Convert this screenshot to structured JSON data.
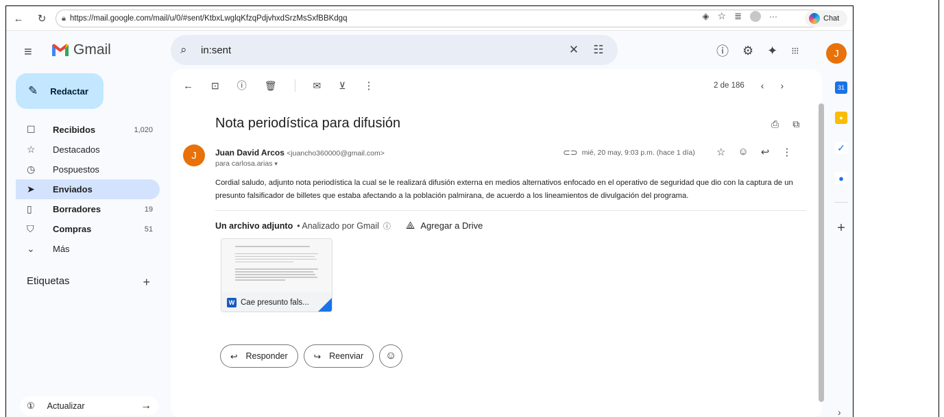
{
  "browser": {
    "url": "https://mail.google.com/mail/u/0/#sent/KtbxLwglqKfzqPdjvhxdSrzMsSxfBBKdgq",
    "chat_label": "Chat",
    "more": "···"
  },
  "header": {
    "brand": "Gmail",
    "search_value": "in:sent",
    "avatar_letter": "J"
  },
  "sidebar": {
    "compose_label": "Redactar",
    "items": [
      {
        "label": "Recibidos",
        "count": "1,020",
        "icon": "inbox-icon",
        "glyph": "☐",
        "bold": true
      },
      {
        "label": "Destacados",
        "count": "",
        "icon": "star-icon",
        "glyph": "☆",
        "bold": false
      },
      {
        "label": "Pospuestos",
        "count": "",
        "icon": "clock-icon",
        "glyph": "◷",
        "bold": false
      },
      {
        "label": "Enviados",
        "count": "",
        "icon": "send-icon",
        "glyph": "➤",
        "bold": true
      },
      {
        "label": "Borradores",
        "count": "19",
        "icon": "draft-icon",
        "glyph": "▯",
        "bold": true
      },
      {
        "label": "Compras",
        "count": "51",
        "icon": "shopping-bag-icon",
        "glyph": "⛉",
        "bold": true
      },
      {
        "label": "Más",
        "count": "",
        "icon": "chevron-down-icon",
        "glyph": "⌄",
        "bold": false
      }
    ],
    "labels_title": "Etiquetas",
    "update_label": "Actualizar"
  },
  "toolbar": {
    "pager_text": "2 de 186"
  },
  "message": {
    "subject": "Nota periodística para difusión",
    "sender_name": "Juan David Arcos",
    "sender_email": "<juancho360000@gmail.com>",
    "to": "para carlosa.arias",
    "date": "mié, 20 may, 9:03 p.m. (hace 1 día)",
    "avatar_letter": "J",
    "body": "Cordial saludo, adjunto nota periodística la cual se le realizará difusión externa en medios alternativos enfocado en el operativo de seguridad que dio con la captura de un presunto falsificador de billetes que estaba afectando a la población palmirana, de acuerdo a los lineamientos de divulgación del programa."
  },
  "attachments": {
    "title": "Un archivo adjunto",
    "scanned": "• Analizado por Gmail",
    "drive_label": "Agregar a Drive",
    "file_name": "Cae presunto fals..."
  },
  "actions": {
    "reply_label": "Responder",
    "forward_label": "Reenviar"
  },
  "colors": {
    "accent_compose": "#c2e7ff",
    "active_nav": "#d3e3fd",
    "avatar": "#e8710a"
  }
}
